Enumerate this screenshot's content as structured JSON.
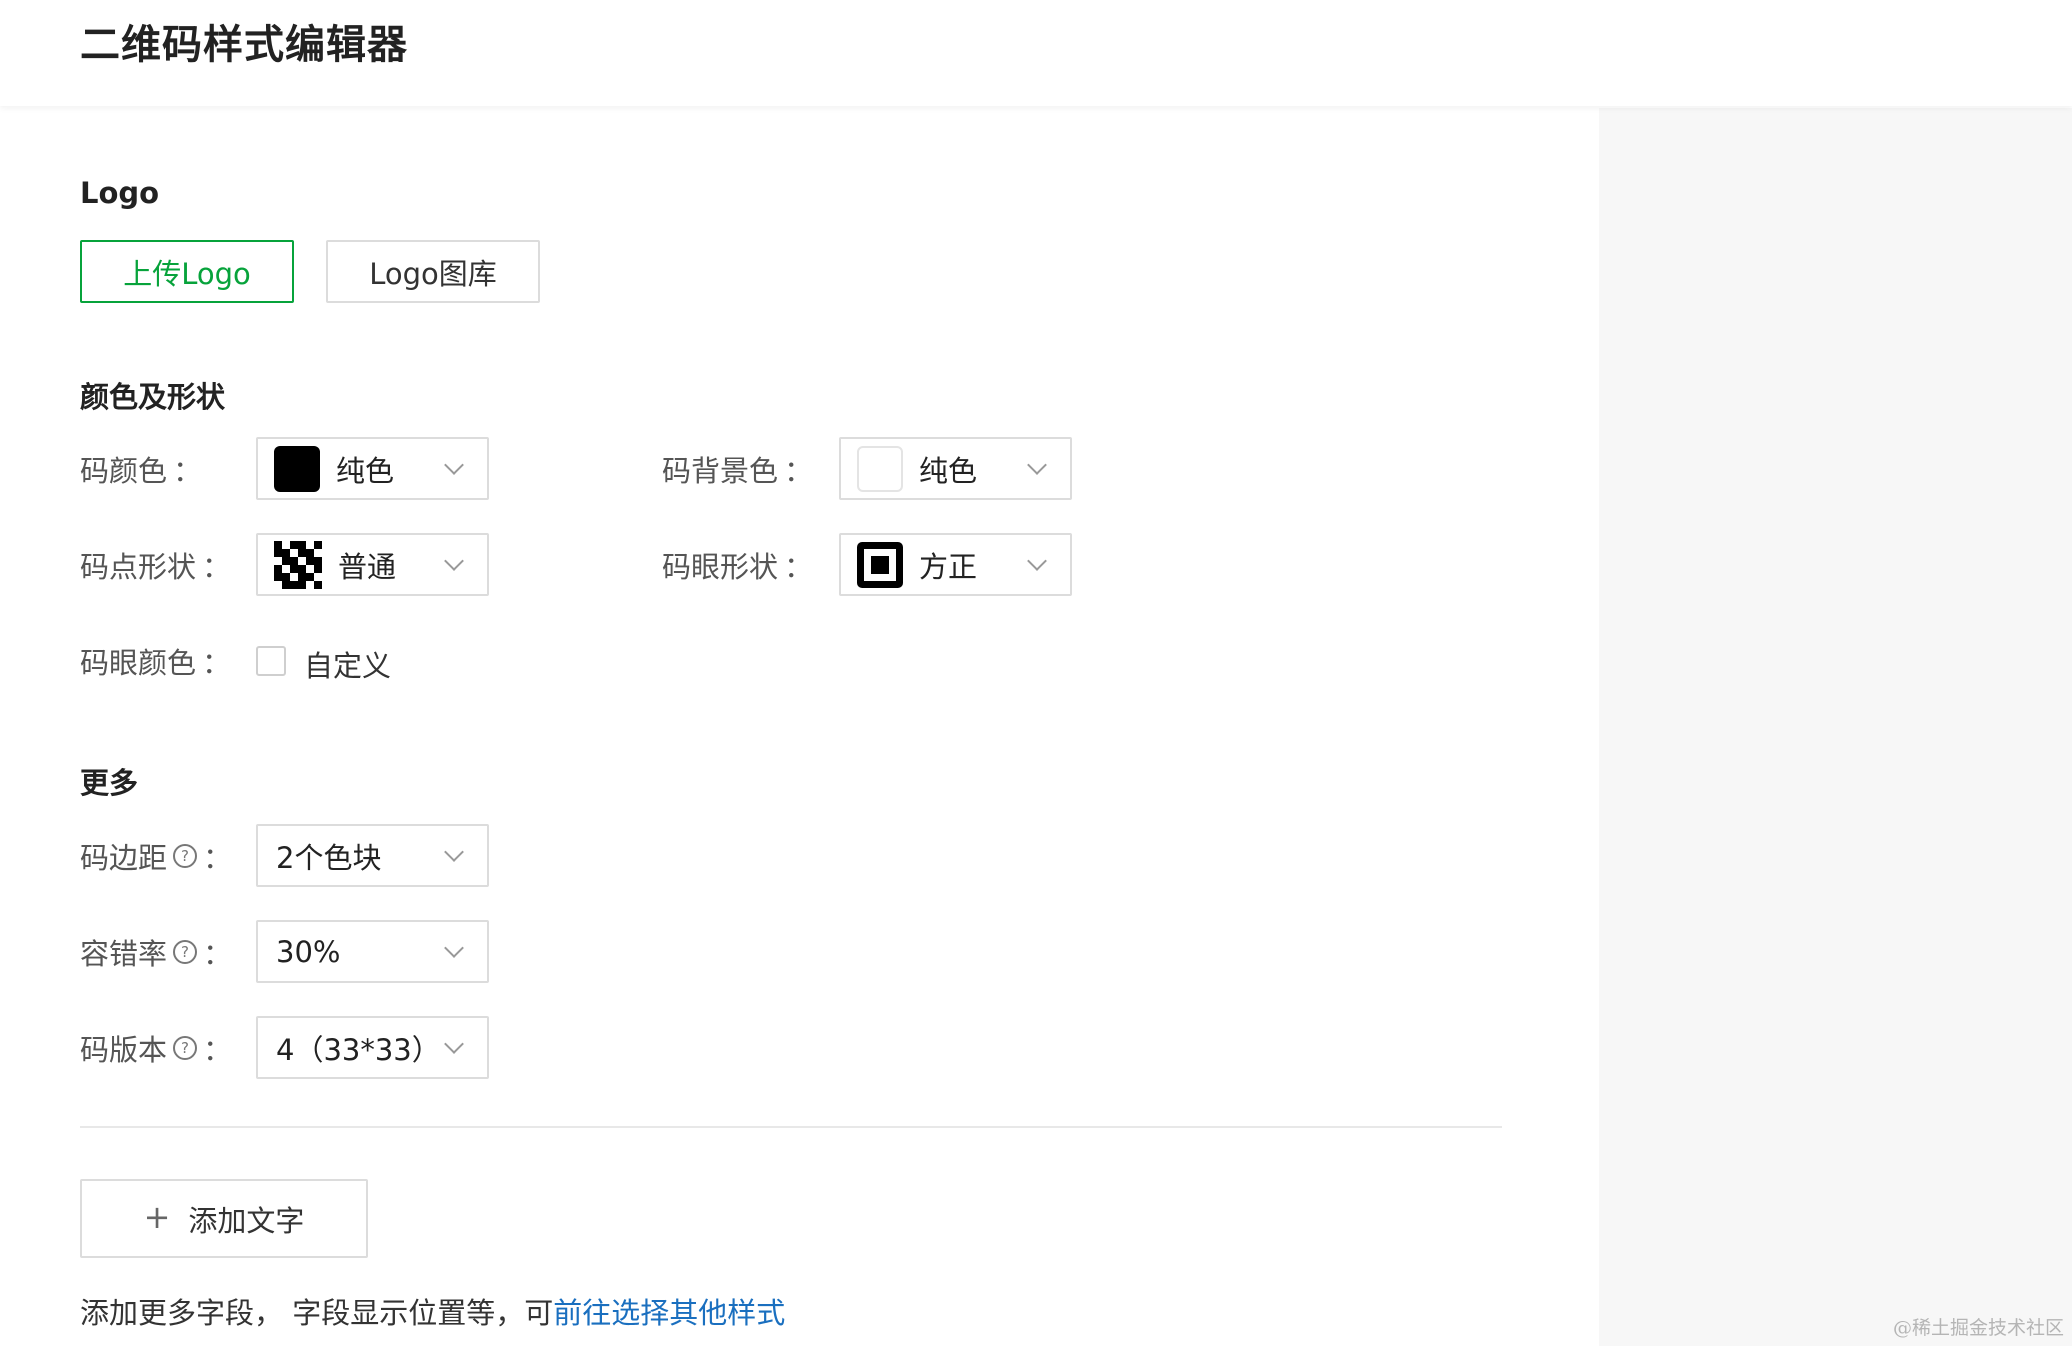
{
  "app": {
    "title": "二维码样式编辑器"
  },
  "logo_section": {
    "title": "Logo",
    "upload_label": "上传Logo",
    "gallery_label": "Logo图库"
  },
  "color_section": {
    "title": "颜色及形状",
    "code_color": {
      "label": "码颜色",
      "value": "纯色",
      "swatch": "#000000"
    },
    "bg_color": {
      "label": "码背景色",
      "value": "纯色",
      "swatch": "#ffffff"
    },
    "dot_shape": {
      "label": "码点形状",
      "value": "普通",
      "icon": "dots-pattern-icon"
    },
    "eye_shape": {
      "label": "码眼形状",
      "value": "方正",
      "icon": "square-eye-icon"
    },
    "eye_color": {
      "label": "码眼颜色",
      "checkbox_label": "自定义",
      "checked": false
    }
  },
  "more_section": {
    "title": "更多",
    "margin": {
      "label": "码边距",
      "value": "2个色块"
    },
    "error_rate": {
      "label": "容错率",
      "value": "30%"
    },
    "version": {
      "label": "码版本",
      "value": "4（33*33）"
    }
  },
  "colon": "：",
  "help_glyph": "?",
  "add_text": {
    "plus": "+",
    "label": "添加文字"
  },
  "footer": {
    "note": "添加更多字段， 字段显示位置等，可",
    "link": "前往选择其他样式"
  },
  "watermark": "@稀土掘金技术社区",
  "colors": {
    "accent_green": "#07a33b",
    "link_blue": "#1a6fbf",
    "panel_bg": "#f7f7f7"
  }
}
